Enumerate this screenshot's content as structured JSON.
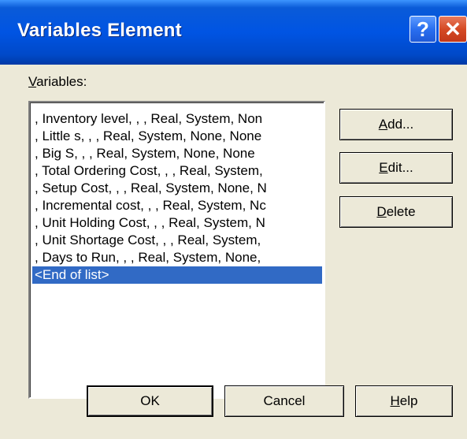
{
  "window": {
    "title": "Variables Element",
    "help_glyph": "?",
    "close_glyph": "✕"
  },
  "variables_label": {
    "accel": "V",
    "rest": "ariables:"
  },
  "variables_list": {
    "items": [
      ", Inventory level, , , Real, System, Non",
      ", Little s, , , Real, System, None, None",
      ", Big S, , , Real, System, None, None",
      ", Total Ordering Cost, , , Real, System,",
      ", Setup Cost, , , Real, System, None, N",
      ", Incremental cost, , , Real, System, Nc",
      ", Unit Holding Cost, , , Real, System, N",
      ", Unit Shortage Cost, , , Real, System,",
      ", Days to Run, , , Real, System, None,",
      "<End of list>"
    ],
    "selected_index": 9
  },
  "buttons": {
    "add": {
      "accel": "A",
      "rest": "dd..."
    },
    "edit": {
      "accel": "E",
      "rest": "dit..."
    },
    "delete": {
      "accel": "D",
      "rest": "elete"
    },
    "ok": "OK",
    "cancel": "Cancel",
    "help": {
      "accel": "H",
      "rest": "elp"
    }
  },
  "colors": {
    "titlebar": "#0054e3",
    "dialog_bg": "#ece9d8",
    "selection": "#316ac5",
    "close_button": "#d54a24"
  }
}
